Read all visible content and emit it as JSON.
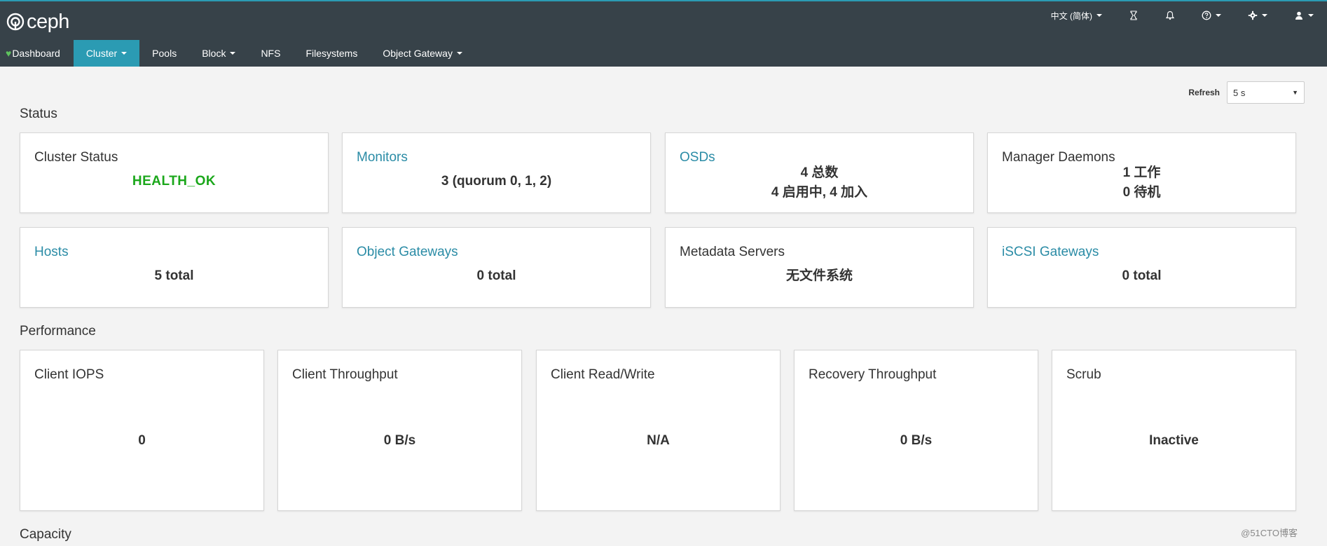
{
  "brand": {
    "name": "ceph"
  },
  "utility": {
    "language": "中文 (简体)",
    "icons": [
      "hourglass-icon",
      "bell-icon",
      "help-icon",
      "gear-icon",
      "user-icon"
    ]
  },
  "nav": {
    "items": [
      {
        "label": "Dashboard",
        "active": false,
        "dropdown": false
      },
      {
        "label": "Cluster",
        "active": true,
        "dropdown": true
      },
      {
        "label": "Pools",
        "active": false,
        "dropdown": false
      },
      {
        "label": "Block",
        "active": false,
        "dropdown": true
      },
      {
        "label": "NFS",
        "active": false,
        "dropdown": false
      },
      {
        "label": "Filesystems",
        "active": false,
        "dropdown": false
      },
      {
        "label": "Object Gateway",
        "active": false,
        "dropdown": true
      }
    ]
  },
  "refresh": {
    "label": "Refresh",
    "value": "5 s"
  },
  "sections": {
    "status": "Status",
    "performance": "Performance",
    "capacity": "Capacity"
  },
  "status_cards": [
    {
      "title": "Cluster Status",
      "link": false,
      "lines": [
        "HEALTH_OK"
      ],
      "ok": true
    },
    {
      "title": "Monitors",
      "link": true,
      "lines": [
        "3 (quorum 0, 1, 2)"
      ]
    },
    {
      "title": "OSDs",
      "link": true,
      "lines": [
        "4 总数",
        "4 启用中, 4 加入"
      ]
    },
    {
      "title": "Manager Daemons",
      "link": false,
      "lines": [
        "1 工作",
        "0 待机"
      ]
    },
    {
      "title": "Hosts",
      "link": true,
      "lines": [
        "5 total"
      ]
    },
    {
      "title": "Object Gateways",
      "link": true,
      "lines": [
        "0 total"
      ]
    },
    {
      "title": "Metadata Servers",
      "link": false,
      "lines": [
        "无文件系统"
      ]
    },
    {
      "title": "iSCSI Gateways",
      "link": true,
      "lines": [
        "0 total"
      ]
    }
  ],
  "performance_cards": [
    {
      "title": "Client IOPS",
      "value": "0"
    },
    {
      "title": "Client Throughput",
      "value": "0 B/s"
    },
    {
      "title": "Client Read/Write",
      "value": "N/A"
    },
    {
      "title": "Recovery Throughput",
      "value": "0 B/s"
    },
    {
      "title": "Scrub",
      "value": "Inactive"
    }
  ],
  "colors": {
    "navbar": "#374249",
    "accent": "#2b9bb3",
    "link": "#2b8ca6",
    "health_ok": "#1ba71b",
    "background": "#f3f3f3"
  },
  "watermark": "@51CTO博客"
}
